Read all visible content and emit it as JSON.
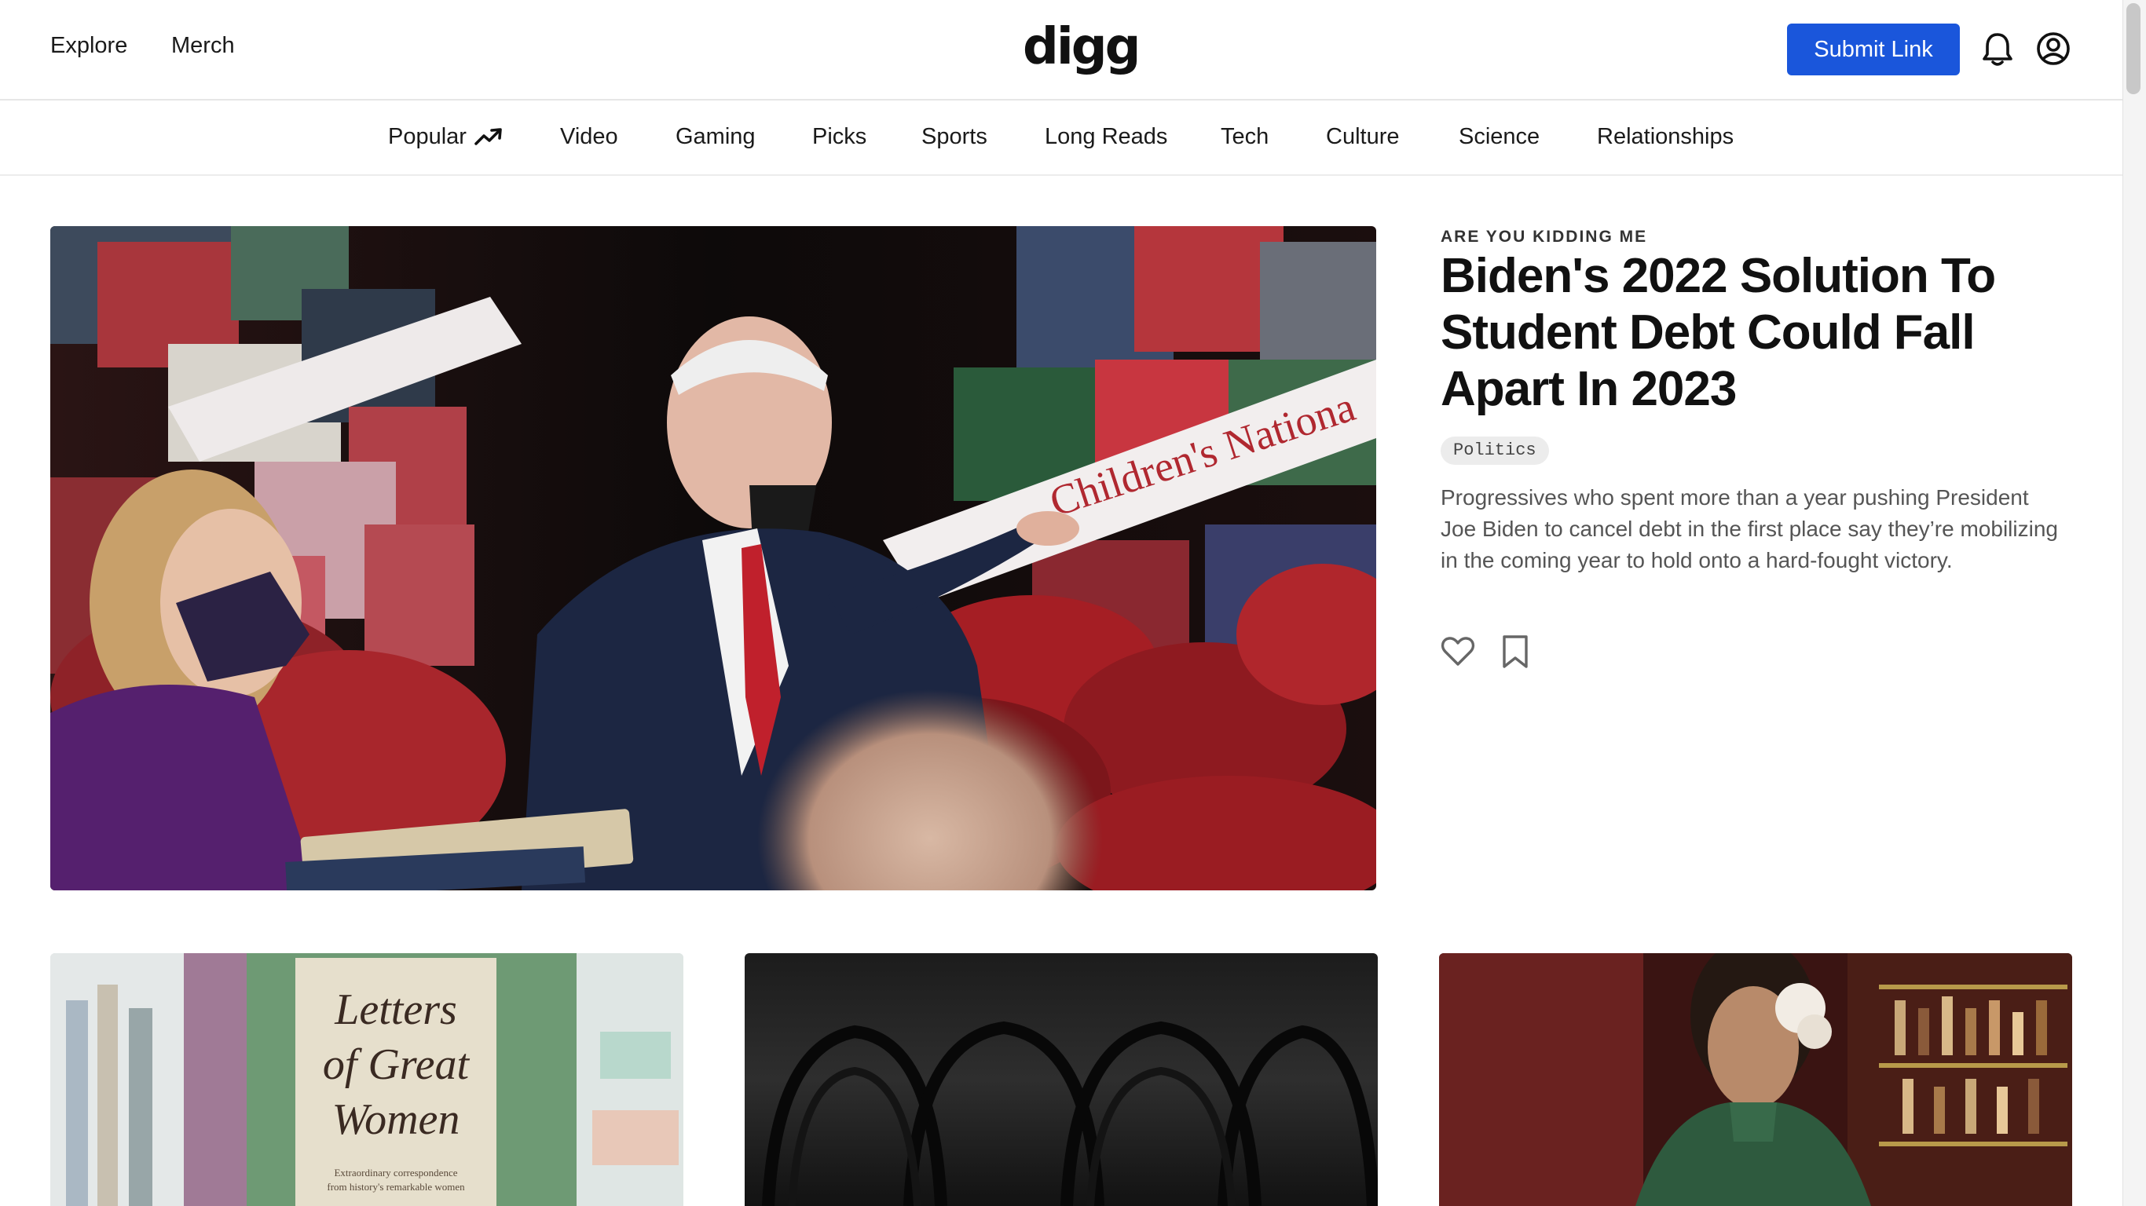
{
  "header": {
    "explore_label": "Explore",
    "merch_label": "Merch",
    "logo_text": "digg",
    "submit_label": "Submit Link",
    "icons": {
      "notifications": "bell-icon",
      "account": "user-circle-icon"
    },
    "accent_color": "#1a56db"
  },
  "nav": {
    "items": [
      {
        "label": "Popular",
        "icon": "trending-up-icon"
      },
      {
        "label": "Video"
      },
      {
        "label": "Gaming"
      },
      {
        "label": "Picks"
      },
      {
        "label": "Sports"
      },
      {
        "label": "Long Reads"
      },
      {
        "label": "Tech"
      },
      {
        "label": "Culture"
      },
      {
        "label": "Science"
      },
      {
        "label": "Relationships"
      }
    ]
  },
  "hero": {
    "kicker": "ARE YOU KIDDING ME",
    "headline": "Biden's 2022 Solution To Student Debt Could Fall Apart In 2023",
    "tag": "Politics",
    "summary": "Progressives who spent more than a year pushing President Joe Biden to cancel debt in the first place say they’re mobilizing in the coming year to hold onto a hard-fought victory.",
    "image_banner_text": "Children's Nationa",
    "actions": {
      "like": "heart-icon",
      "save": "bookmark-icon"
    }
  },
  "cards": [
    {
      "book_title": "Letters of Great Women",
      "book_subtitle_1": "Extraordinary correspondence",
      "book_subtitle_2": "from history's remarkable women"
    },
    {},
    {}
  ]
}
